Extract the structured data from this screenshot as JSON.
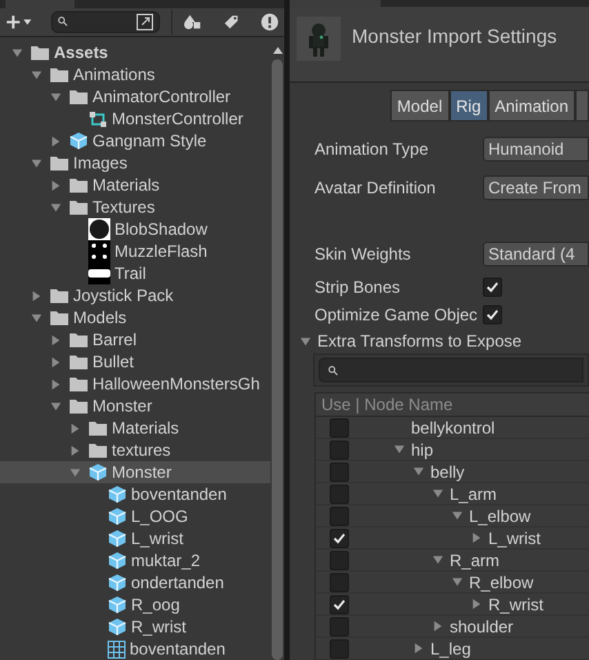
{
  "project": {
    "tree": [
      {
        "label": "Assets",
        "kind": "folder",
        "expanded": true,
        "selected": false,
        "children": [
          {
            "label": "Animations",
            "kind": "folder",
            "expanded": true,
            "selected": false,
            "children": [
              {
                "label": "AnimatorController",
                "kind": "folder",
                "expanded": true,
                "selected": false,
                "children": [
                  {
                    "label": "MonsterController",
                    "kind": "controller",
                    "selected": false
                  }
                ]
              },
              {
                "label": "Gangnam Style",
                "kind": "model",
                "expanded": false,
                "selected": false
              }
            ]
          },
          {
            "label": "Images",
            "kind": "folder",
            "expanded": true,
            "selected": false,
            "children": [
              {
                "label": "Materials",
                "kind": "folder",
                "expanded": false,
                "selected": false
              },
              {
                "label": "Textures",
                "kind": "folder",
                "expanded": true,
                "selected": false,
                "children": [
                  {
                    "label": "BlobShadow",
                    "kind": "blob",
                    "selected": false
                  },
                  {
                    "label": "MuzzleFlash",
                    "kind": "sparks",
                    "selected": false
                  },
                  {
                    "label": "Trail",
                    "kind": "streak",
                    "selected": false
                  }
                ]
              }
            ]
          },
          {
            "label": "Joystick Pack",
            "kind": "folder",
            "expanded": false,
            "selected": false
          },
          {
            "label": "Models",
            "kind": "folder",
            "expanded": true,
            "selected": false,
            "children": [
              {
                "label": "Barrel",
                "kind": "folder",
                "expanded": false,
                "selected": false
              },
              {
                "label": "Bullet",
                "kind": "folder",
                "expanded": false,
                "selected": false
              },
              {
                "label": "HalloweenMonstersGh",
                "kind": "folder",
                "expanded": false,
                "selected": false
              },
              {
                "label": "Monster",
                "kind": "folder",
                "expanded": true,
                "selected": false,
                "children": [
                  {
                    "label": "Materials",
                    "kind": "folder",
                    "expanded": false,
                    "selected": false
                  },
                  {
                    "label": "textures",
                    "kind": "folder",
                    "expanded": false,
                    "selected": false
                  },
                  {
                    "label": "Monster",
                    "kind": "model",
                    "expanded": true,
                    "selected": true,
                    "children": [
                      {
                        "label": "boventanden",
                        "kind": "model",
                        "selected": false
                      },
                      {
                        "label": "L_OOG",
                        "kind": "model",
                        "selected": false
                      },
                      {
                        "label": "L_wrist",
                        "kind": "model",
                        "selected": false
                      },
                      {
                        "label": "muktar_2",
                        "kind": "model",
                        "selected": false
                      },
                      {
                        "label": "ondertanden",
                        "kind": "model",
                        "selected": false
                      },
                      {
                        "label": "R_oog",
                        "kind": "model",
                        "selected": false
                      },
                      {
                        "label": "R_wrist",
                        "kind": "model",
                        "selected": false
                      },
                      {
                        "label": "boventanden",
                        "kind": "mesh",
                        "selected": false
                      }
                    ]
                  }
                ]
              }
            ]
          }
        ]
      }
    ]
  },
  "inspector": {
    "title": "Monster Import Settings",
    "tabs": [
      {
        "label": "Model",
        "selected": false
      },
      {
        "label": "Rig",
        "selected": true
      },
      {
        "label": "Animation",
        "selected": false
      }
    ],
    "fields": [
      {
        "kind": "dropdown",
        "label": "Animation Type",
        "value": "Humanoid"
      },
      {
        "kind": "dropdown",
        "label": "Avatar Definition",
        "value": "Create From"
      },
      {
        "kind": "gap"
      },
      {
        "kind": "dropdown",
        "label": "Skin Weights",
        "value": "Standard (4"
      },
      {
        "kind": "checkbox",
        "label": "Strip Bones",
        "checked": true
      },
      {
        "kind": "checkbox",
        "label": "Optimize Game Objec",
        "checked": true
      }
    ],
    "section": {
      "label": "Extra Transforms to Expose",
      "expanded": true
    },
    "table": {
      "header": "Use | Node Name",
      "nodes": [
        {
          "label": "bellykontrol",
          "checked": false
        },
        {
          "label": "hip",
          "checked": false,
          "expanded": true,
          "children": [
            {
              "label": "belly",
              "checked": false,
              "expanded": true,
              "children": [
                {
                  "label": "L_arm",
                  "checked": false,
                  "expanded": true,
                  "children": [
                    {
                      "label": "L_elbow",
                      "checked": false,
                      "expanded": true,
                      "children": [
                        {
                          "label": "L_wrist",
                          "checked": true,
                          "expanded": false
                        }
                      ]
                    }
                  ]
                },
                {
                  "label": "R_arm",
                  "checked": false,
                  "expanded": true,
                  "children": [
                    {
                      "label": "R_elbow",
                      "checked": false,
                      "expanded": true,
                      "children": [
                        {
                          "label": "R_wrist",
                          "checked": true,
                          "expanded": false
                        }
                      ]
                    }
                  ]
                },
                {
                  "label": "shoulder",
                  "checked": false,
                  "expanded": false
                }
              ]
            },
            {
              "label": "L_leg",
              "checked": false,
              "expanded": false
            }
          ]
        }
      ]
    }
  }
}
